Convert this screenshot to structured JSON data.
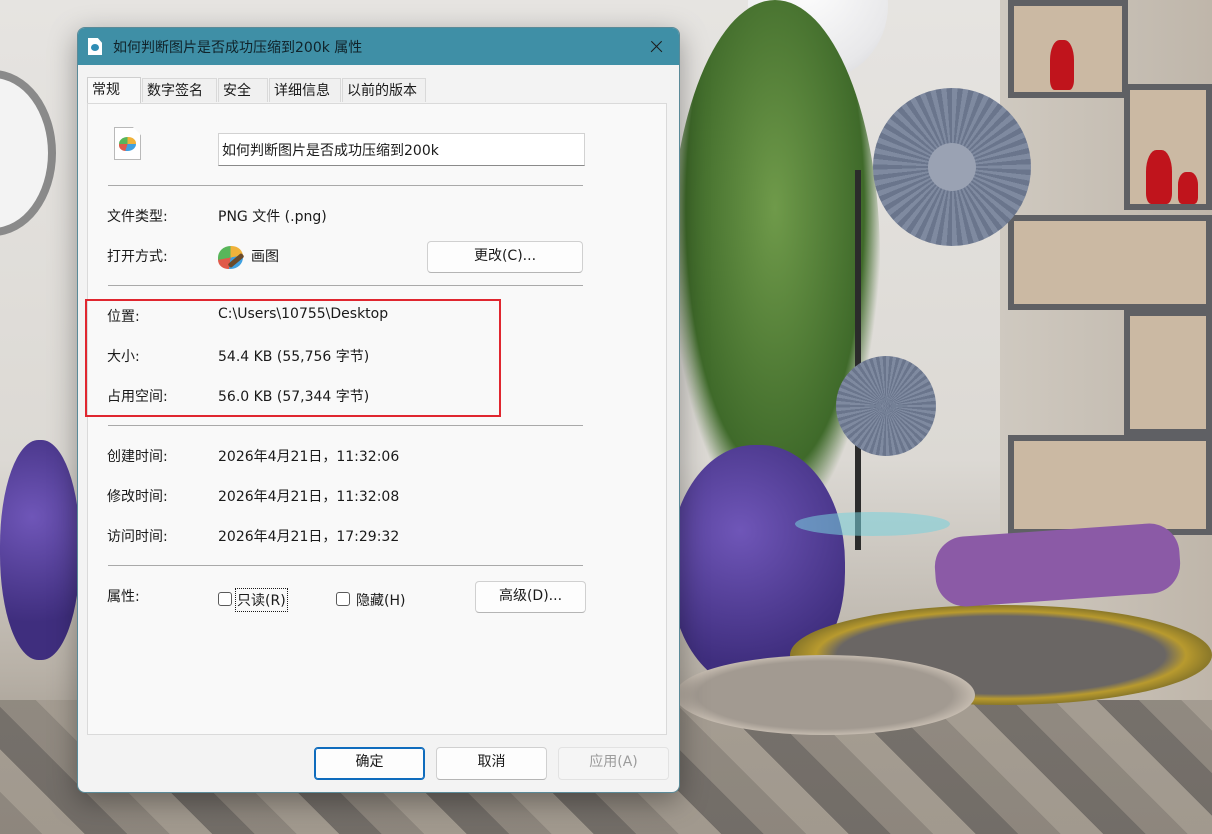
{
  "window": {
    "title": "如何判断图片是否成功压缩到200k 属性",
    "title_icon": "file-icon",
    "close_icon": "close-icon"
  },
  "tabs": [
    {
      "label": "常规",
      "active": true
    },
    {
      "label": "数字签名",
      "active": false
    },
    {
      "label": "安全",
      "active": false
    },
    {
      "label": "详细信息",
      "active": false
    },
    {
      "label": "以前的版本",
      "active": false
    }
  ],
  "general": {
    "file_name": "如何判断图片是否成功压缩到200k",
    "file_icon": "png-image-file-icon",
    "file_type_label": "文件类型:",
    "file_type_value": "PNG 文件 (.png)",
    "open_with_label": "打开方式:",
    "open_with_app": "画图",
    "open_with_icon": "paint-app-icon",
    "change_button": "更改(C)...",
    "location_label": "位置:",
    "location_value": "C:\\Users\\10755\\Desktop",
    "size_label": "大小:",
    "size_value": "54.4 KB (55,756 字节)",
    "size_on_disk_label": "占用空间:",
    "size_on_disk_value": "56.0 KB (57,344 字节)",
    "created_label": "创建时间:",
    "created_value": "2026年4月21日，11:32:06",
    "modified_label": "修改时间:",
    "modified_value": "2026年4月21日，11:32:08",
    "accessed_label": "访问时间:",
    "accessed_value": "2026年4月21日，17:29:32",
    "attributes_label": "属性:",
    "readonly_label": "只读(R)",
    "readonly_checked": false,
    "hidden_label": "隐藏(H)",
    "hidden_checked": false,
    "advanced_button": "高级(D)..."
  },
  "footer": {
    "ok_button": "确定",
    "cancel_button": "取消",
    "apply_button": "应用(A)"
  },
  "colors": {
    "titlebar": "#3f8fa6",
    "highlight_box": "#e0262f",
    "primary_border": "#0f6cbd"
  }
}
